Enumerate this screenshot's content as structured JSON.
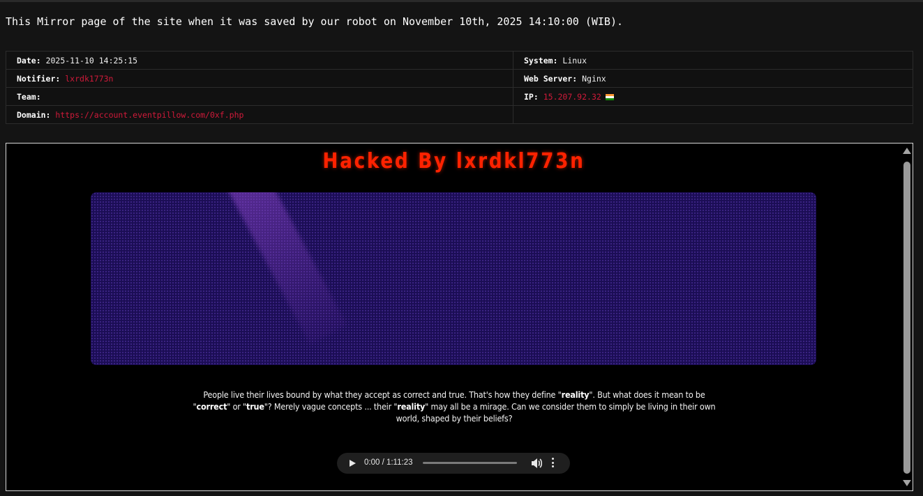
{
  "notice": "This Mirror page of the site when it was saved by our robot on November 10th, 2025 14:10:00 (WIB).",
  "info": {
    "date_label": "Date:",
    "date_value": "2025-11-10 14:25:15",
    "notifier_label": "Notifier:",
    "notifier_value": "lxrdk1773n",
    "team_label": "Team:",
    "team_value": "",
    "domain_label": "Domain:",
    "domain_value": "https://account.eventpillow.com/0xf.php",
    "system_label": "System:",
    "system_value": "Linux",
    "webserver_label": "Web Server:",
    "webserver_value": "Nginx",
    "ip_label": "IP:",
    "ip_value": "15.207.92.32",
    "ip_flag_icon": "india-flag-icon"
  },
  "mirror": {
    "title": "Hacked By lxrdkl773n",
    "quote": {
      "p1": "People live their lives bound by what they accept as correct and true. That's how they define \"",
      "w1": "reality",
      "p2": "\". But what does it mean to be \"",
      "w2": "correct",
      "p3": "\" or \"",
      "w3": "true",
      "p4": "\"? Merely vague concepts ... their \"",
      "w4": "reality",
      "p5": "\" may all be a mirage. Can we consider them to simply be living in their own world, shaped by their beliefs?"
    },
    "audio": {
      "time": "0:00 / 1:11:23",
      "progress": 0
    }
  },
  "colors": {
    "accent_red": "#d11a3a",
    "title_red": "#ff2200",
    "banner_purple": "#1b0d55"
  }
}
